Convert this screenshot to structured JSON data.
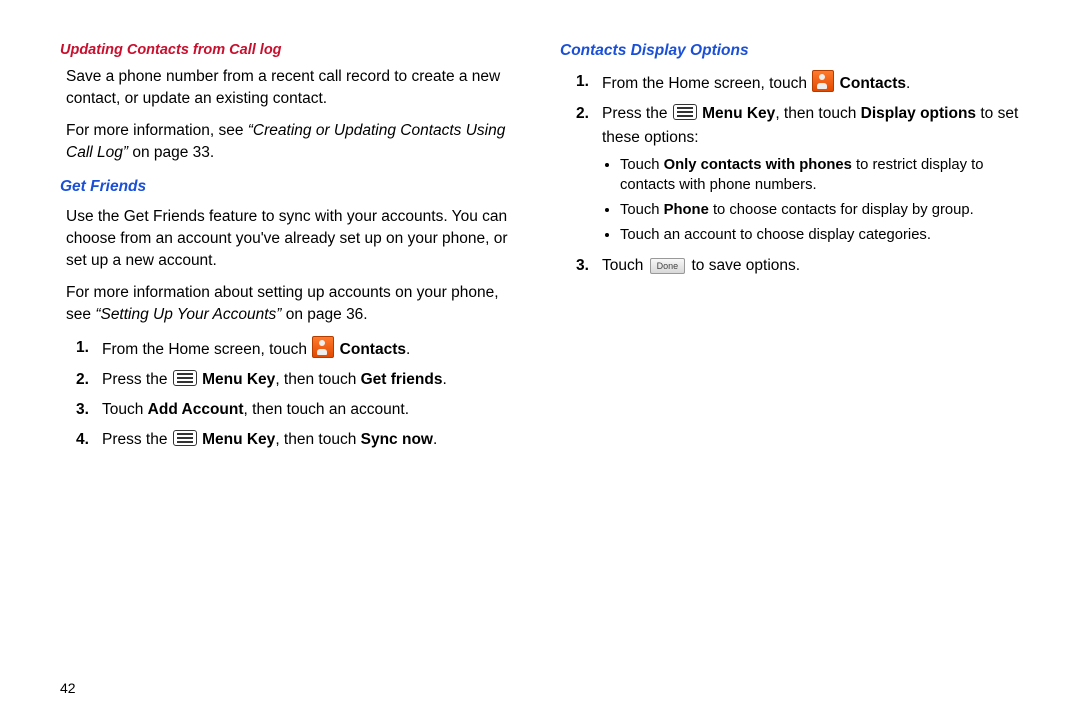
{
  "pageNumber": "42",
  "left": {
    "sec1": {
      "title": "Updating Contacts from Call log",
      "p1": "Save a phone number from a recent call record to create a new contact, or update an existing contact.",
      "p2a": "For more information, see ",
      "p2i": "“Creating or Updating Contacts Using Call Log”",
      "p2b": " on page 33."
    },
    "sec2": {
      "title": "Get Friends",
      "p1": "Use the Get Friends feature to sync with your accounts. You can choose from an account you've already set up on your phone, or set up a new account.",
      "p2a": "For more information about setting up accounts on your phone, see ",
      "p2i": "“Setting Up Your Accounts”",
      "p2b": " on page 36.",
      "steps": {
        "s1a": "From the Home screen, touch ",
        "s1b": "Contacts",
        "s1c": ".",
        "s2a": "Press the ",
        "s2b": "Menu Key",
        "s2c": ", then touch ",
        "s2d": "Get friends",
        "s2e": ".",
        "s3a": "Touch ",
        "s3b": "Add Account",
        "s3c": ", then touch an account.",
        "s4a": "Press the ",
        "s4b": "Menu Key",
        "s4c": ", then touch ",
        "s4d": "Sync now",
        "s4e": "."
      }
    }
  },
  "right": {
    "title": "Contacts Display Options",
    "steps": {
      "s1a": "From the Home screen, touch ",
      "s1b": "Contacts",
      "s1c": ".",
      "s2a": "Press the ",
      "s2b": "Menu Key",
      "s2c": ", then touch ",
      "s2d": "Display options",
      "s2e": " to set these options:",
      "b1a": "Touch ",
      "b1b": "Only contacts with phones",
      "b1c": " to restrict display to contacts with phone numbers.",
      "b2a": "Touch ",
      "b2b": "Phone",
      "b2c": " to choose contacts for display by group.",
      "b3": "Touch an account to choose display categories.",
      "s3a": "Touch ",
      "s3b": "Done",
      "s3c": " to save options."
    }
  }
}
